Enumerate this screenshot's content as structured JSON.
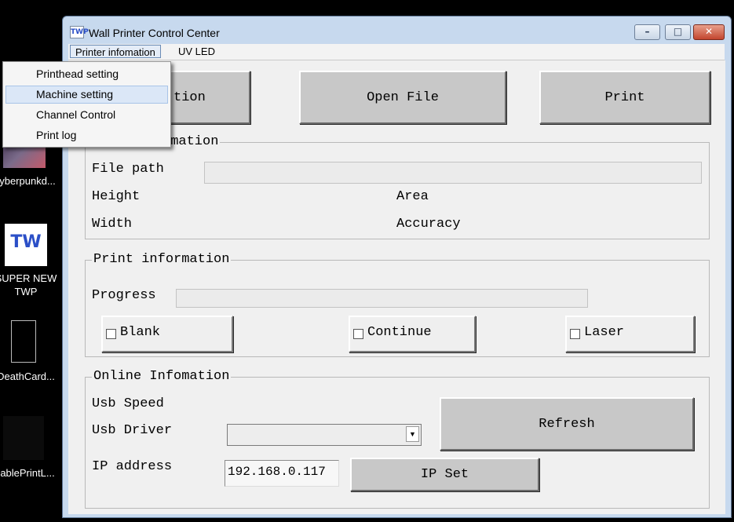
{
  "window": {
    "title": "Wall Printer Control Center",
    "icon_text": "TWP"
  },
  "menubar": {
    "items": [
      "Printer infomation",
      "UV LED"
    ]
  },
  "dropdown": {
    "items": [
      "Printhead setting",
      "Machine setting",
      "Channel Control",
      "Print log"
    ],
    "highlighted_index": 1
  },
  "desktop": {
    "icons": [
      "yberpunkd...",
      "SUPER NEW TWP",
      "DeathCard...",
      "ablePrintL..."
    ]
  },
  "toolbar": {
    "connection_fragment": "tion",
    "open_file": "Open File",
    "print": "Print"
  },
  "file_info": {
    "title_fragment": "rmation",
    "file_path_label": "File path",
    "height_label": "Height",
    "width_label": "Width",
    "area_label": "Area",
    "accuracy_label": "Accuracy"
  },
  "print_info": {
    "title": "Print information",
    "progress_label": "Progress",
    "progress_value": 0,
    "blank": "Blank",
    "continue": "Continue",
    "laser": "Laser"
  },
  "online_info": {
    "title": "Online Infomation",
    "usb_speed_label": "Usb Speed",
    "usb_driver_label": "Usb Driver",
    "ip_address_label": "IP address",
    "ip_value": "192.168.0.117",
    "ip_set": "IP Set",
    "refresh": "Refresh"
  }
}
